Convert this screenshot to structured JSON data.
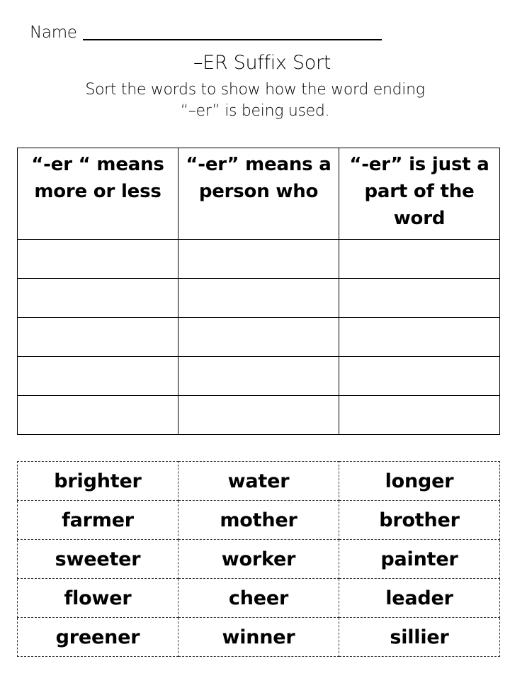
{
  "header": {
    "name_label": "Name",
    "title": "–ER Suffix Sort",
    "instructions_line1": "Sort the words to show how the word ending",
    "instructions_line2": "“–er” is being used."
  },
  "sort_table": {
    "columns": [
      {
        "label": "“-er “ means more or less"
      },
      {
        "label": "“-er” means a person who"
      },
      {
        "label": "“-er” is just a part of the word"
      }
    ],
    "empty_rows": 5
  },
  "word_cards": {
    "rows": [
      [
        "brighter",
        "water",
        "longer"
      ],
      [
        "farmer",
        "mother",
        "brother"
      ],
      [
        "sweeter",
        "worker",
        "painter"
      ],
      [
        "flower",
        "cheer",
        "leader"
      ],
      [
        "greener",
        "winner",
        "sillier"
      ]
    ]
  }
}
